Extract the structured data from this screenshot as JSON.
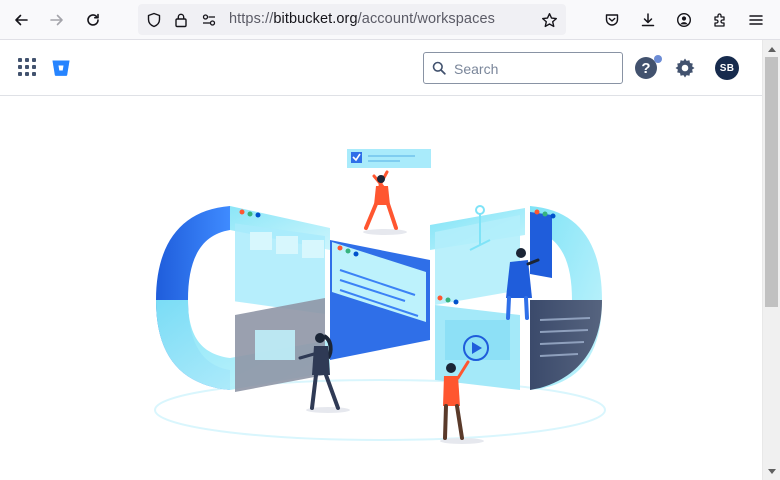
{
  "browser": {
    "url_prefix": "https://",
    "url_domain": "bitbucket.org",
    "url_path": "/account/workspaces"
  },
  "header": {
    "search": {
      "placeholder": "Search"
    },
    "help_label": "?",
    "avatar_initials": "SB"
  },
  "colors": {
    "brand": "#2684ff",
    "header_icon": "#42526e",
    "avatar_bg": "#172b4d"
  },
  "icons": [
    "back-icon",
    "forward-icon",
    "reload-icon",
    "shield-icon",
    "lock-icon",
    "permissions-icon",
    "bookmark-star-icon",
    "pocket-icon",
    "download-icon",
    "account-icon",
    "extensions-icon",
    "menu-icon",
    "app-switcher-icon",
    "bitbucket-logo-icon",
    "search-icon",
    "help-icon",
    "gear-icon"
  ]
}
